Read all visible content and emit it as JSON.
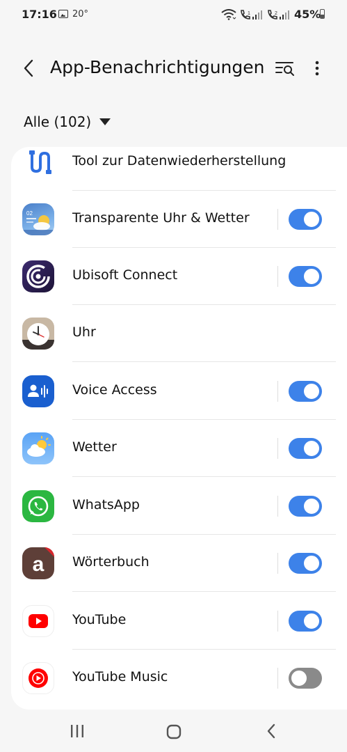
{
  "status_bar": {
    "time": "17:16",
    "temperature": "20°",
    "battery": "45%",
    "battery_level": 0.45,
    "icons": [
      "image-icon",
      "wifi-icon",
      "volte-call-icon",
      "signal-icon",
      "volte-call-2-icon",
      "signal-2-icon",
      "battery-icon"
    ]
  },
  "header": {
    "title": "App-Benachrichtigungen",
    "icons": [
      "back-icon",
      "search-filter-icon",
      "more-icon"
    ]
  },
  "filter": {
    "label": "Alle (102)",
    "icon": "chevron-down-icon"
  },
  "apps": [
    {
      "name": "Tool zur Datenwiederherstellung",
      "icon": "data-restore-icon",
      "toggle": null
    },
    {
      "name": "Transparente Uhr & Wetter",
      "icon": "transparent-clock-weather-icon",
      "toggle": true
    },
    {
      "name": "Ubisoft Connect",
      "icon": "ubisoft-icon",
      "toggle": true
    },
    {
      "name": "Uhr",
      "icon": "clock-icon",
      "toggle": null
    },
    {
      "name": "Voice Access",
      "icon": "voice-access-icon",
      "toggle": true
    },
    {
      "name": "Wetter",
      "icon": "weather-icon",
      "toggle": true
    },
    {
      "name": "WhatsApp",
      "icon": "whatsapp-icon",
      "toggle": true
    },
    {
      "name": "Wörterbuch",
      "icon": "dictionary-icon",
      "toggle": true
    },
    {
      "name": "YouTube",
      "icon": "youtube-icon",
      "toggle": true
    },
    {
      "name": "YouTube Music",
      "icon": "youtube-music-icon",
      "toggle": false
    }
  ],
  "dictionary_letter": "a",
  "nav_bar": {
    "icons": [
      "recent-apps-icon",
      "home-icon",
      "back-icon"
    ]
  },
  "colors": {
    "toggle_on": "#3d82e9",
    "toggle_off": "#8a8a8a",
    "background": "#f6f6f6",
    "card": "#ffffff"
  }
}
